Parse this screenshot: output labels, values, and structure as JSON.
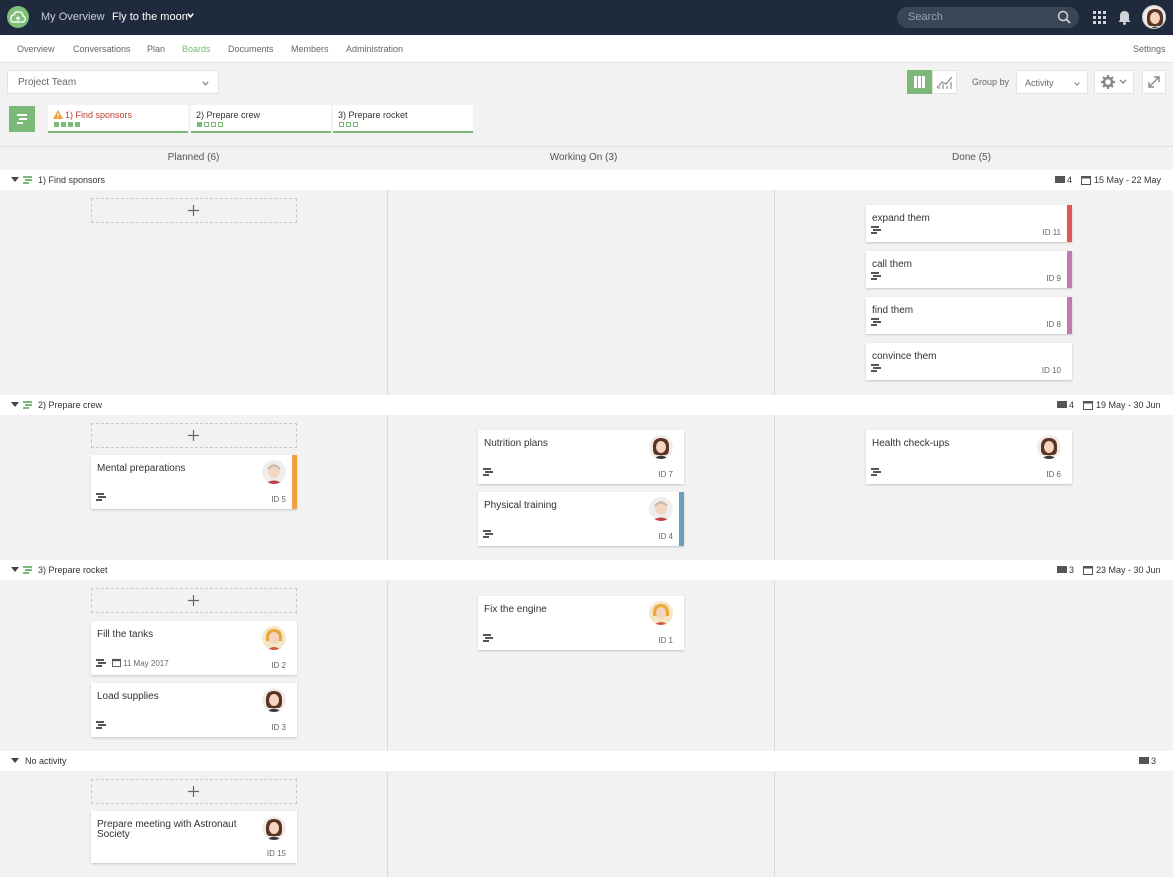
{
  "topbar": {
    "my_overview": "My Overview",
    "project": "Fly to the moon",
    "search_placeholder": "Search"
  },
  "nav": {
    "items": [
      "Overview",
      "Conversations",
      "Plan",
      "Boards",
      "Documents",
      "Members",
      "Administration"
    ],
    "active": "Boards",
    "settings": "Settings"
  },
  "toolbar": {
    "team_select": "Project Team",
    "group_by_label": "Group by",
    "group_by_value": "Activity"
  },
  "activities": [
    {
      "label": "1) Find sponsors",
      "progress": [
        1,
        1,
        1,
        1
      ],
      "warning": true
    },
    {
      "label": "2) Prepare crew",
      "progress": [
        1,
        0,
        0,
        0
      ],
      "warning": false
    },
    {
      "label": "3) Prepare rocket",
      "progress": [
        0,
        0,
        0
      ],
      "warning": false
    }
  ],
  "columns": [
    "Planned (6)",
    "Working On (3)",
    "Done (5)"
  ],
  "lanes": [
    {
      "name": "1) Find sponsors",
      "count": "4",
      "dates": "15 May - 22 May"
    },
    {
      "name": "2) Prepare crew",
      "count": "4",
      "dates": "19 May - 30 Jun"
    },
    {
      "name": "3) Prepare rocket",
      "count": "3",
      "dates": "23 May - 30 Jun"
    },
    {
      "name": "No activity",
      "count": "3",
      "dates": ""
    }
  ],
  "cards": {
    "expand": {
      "title": "expand them",
      "id": "ID 11"
    },
    "call": {
      "title": "call them",
      "id": "ID 9"
    },
    "find": {
      "title": "find them",
      "id": "ID 8"
    },
    "convince": {
      "title": "convince them",
      "id": "ID 10"
    },
    "mental": {
      "title": "Mental preparations",
      "id": "ID 5"
    },
    "nutrition": {
      "title": "Nutrition plans",
      "id": "ID 7"
    },
    "physical": {
      "title": "Physical training",
      "id": "ID 4"
    },
    "health": {
      "title": "Health check-ups",
      "id": "ID 6"
    },
    "fill": {
      "title": "Fill the tanks",
      "id": "ID 2",
      "date": "11 May 2017"
    },
    "load": {
      "title": "Load supplies",
      "id": "ID 3"
    },
    "engine": {
      "title": "Fix the engine",
      "id": "ID 1"
    },
    "meeting": {
      "title": "Prepare meeting with Astronaut Society",
      "id": "ID 15"
    }
  },
  "colors": {
    "accent": "#7ab978",
    "topbar": "#1f2b3c",
    "red": "#e05555",
    "purple": "#c07ab0",
    "orange": "#f0a040",
    "blue": "#6a9ec0"
  }
}
